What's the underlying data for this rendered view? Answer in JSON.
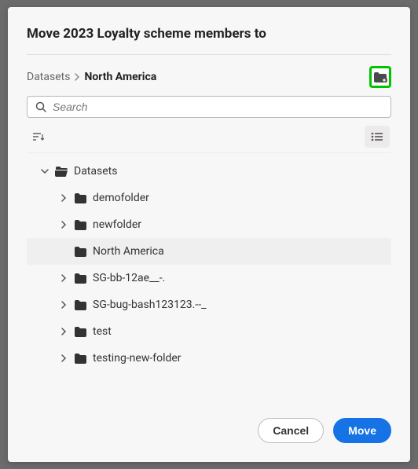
{
  "dialog": {
    "title": "Move 2023 Loyalty scheme members to"
  },
  "breadcrumb": {
    "root": "Datasets",
    "current": "North America"
  },
  "search": {
    "placeholder": "Search",
    "value": ""
  },
  "toolbar": {
    "sort_label": "",
    "new_folder_icon": "new-folder-icon",
    "view_icon": "list-view-icon"
  },
  "tree": {
    "root": {
      "label": "Datasets",
      "expanded": true,
      "open": true
    },
    "children": [
      {
        "label": "demofolder",
        "expanded": false,
        "selected": false
      },
      {
        "label": "newfolder",
        "expanded": false,
        "selected": false
      },
      {
        "label": "North America",
        "expanded": false,
        "selected": true
      },
      {
        "label": "SG-bb-12ae__-.",
        "expanded": false,
        "selected": false
      },
      {
        "label": "SG-bug-bash123123.--_",
        "expanded": false,
        "selected": false
      },
      {
        "label": "test",
        "expanded": false,
        "selected": false
      },
      {
        "label": "testing-new-folder",
        "expanded": false,
        "selected": false
      }
    ]
  },
  "footer": {
    "cancel_label": "Cancel",
    "move_label": "Move"
  },
  "icons": {
    "search": "search-icon",
    "sort": "sort-icon",
    "chevron_right": "chevron-right-icon",
    "chevron_down": "chevron-down-icon",
    "folder_closed": "folder-closed-icon",
    "folder_open": "folder-open-icon"
  },
  "colors": {
    "primary": "#1673e6",
    "highlight_ring": "#00c400",
    "selected_bg": "#efefef",
    "dialog_bg": "#f7f7f7"
  }
}
